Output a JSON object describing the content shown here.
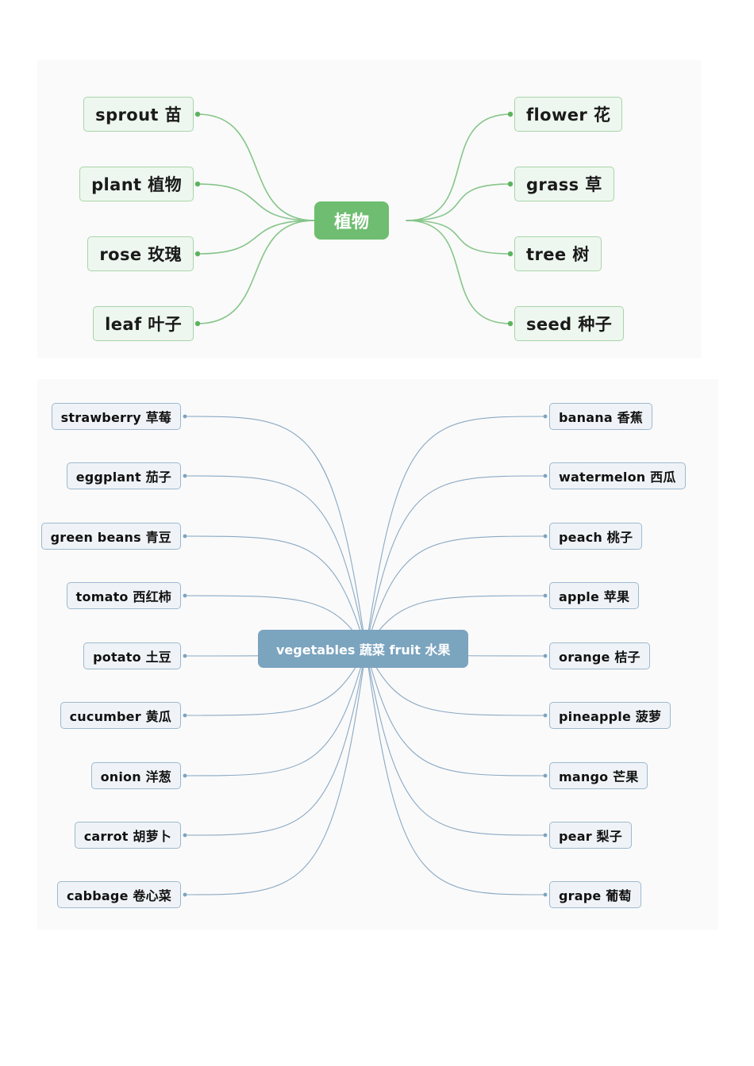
{
  "colors": {
    "panel_background": "#fafafa",
    "page_background": "#ffffff",
    "plants_accent": "#6fbd70",
    "plants_node_fill": "#eef7ef",
    "plants_node_border": "#a8d5a9",
    "food_accent": "#7ba4bf",
    "food_node_fill": "#eff3f7",
    "food_node_border": "#9db9cf"
  },
  "maps": [
    {
      "id": "plants",
      "center": {
        "label": "植物"
      },
      "left_nodes": [
        {
          "label": "sprout  苗"
        },
        {
          "label": "plant  植物"
        },
        {
          "label": "rose  玫瑰"
        },
        {
          "label": "leaf   叶子"
        }
      ],
      "right_nodes": [
        {
          "label": "flower 花"
        },
        {
          "label": "grass  草"
        },
        {
          "label": "tree   树"
        },
        {
          "label": "seed  种子"
        }
      ]
    },
    {
      "id": "food",
      "center": {
        "label": "vegetables 蔬菜    fruit  水果"
      },
      "left_nodes": [
        {
          "label": "strawberry  草莓"
        },
        {
          "label": "eggplant  茄子"
        },
        {
          "label": "green beans  青豆"
        },
        {
          "label": "tomato  西红柿"
        },
        {
          "label": "potato  土豆"
        },
        {
          "label": "cucumber  黄瓜"
        },
        {
          "label": "onion  洋葱"
        },
        {
          "label": "carrot  胡萝卜"
        },
        {
          "label": "cabbage  卷心菜"
        }
      ],
      "right_nodes": [
        {
          "label": "banana  香蕉"
        },
        {
          "label": "watermelon  西瓜"
        },
        {
          "label": "peach  桃子"
        },
        {
          "label": "apple  苹果"
        },
        {
          "label": "orange  桔子"
        },
        {
          "label": "pineapple  菠萝"
        },
        {
          "label": "mango  芒果"
        },
        {
          "label": "pear  梨子"
        },
        {
          "label": "grape  葡萄"
        }
      ]
    }
  ]
}
